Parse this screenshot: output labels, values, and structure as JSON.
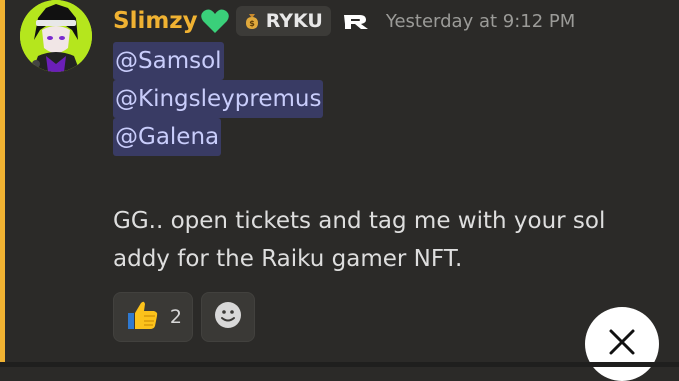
{
  "message": {
    "username": "Slimzy",
    "username_color": "#f0b232",
    "badge_icon": "green-heart-icon",
    "server_tag": {
      "icon": "money-bag-icon",
      "label": "RYKU"
    },
    "app_icon": "raiku-logo-icon",
    "timestamp": "Yesterday at 9:12 PM",
    "mentions": [
      "@Samsol",
      "@Kingsleypremus",
      "@Galena"
    ],
    "text": "GG.. open tickets and tag me with your sol addy for the Raiku gamer NFT.",
    "reactions": [
      {
        "emoji": "thumbs-up-icon",
        "count": "2"
      },
      {
        "emoji": "add-reaction-icon"
      }
    ]
  },
  "overlay": {
    "close_icon": "close-icon"
  },
  "colors": {
    "background": "#2b2a28",
    "mention_highlight_bar": "#f0b232",
    "mention_text": "#c9cdfb",
    "avatar_background": "#b5e61d"
  }
}
